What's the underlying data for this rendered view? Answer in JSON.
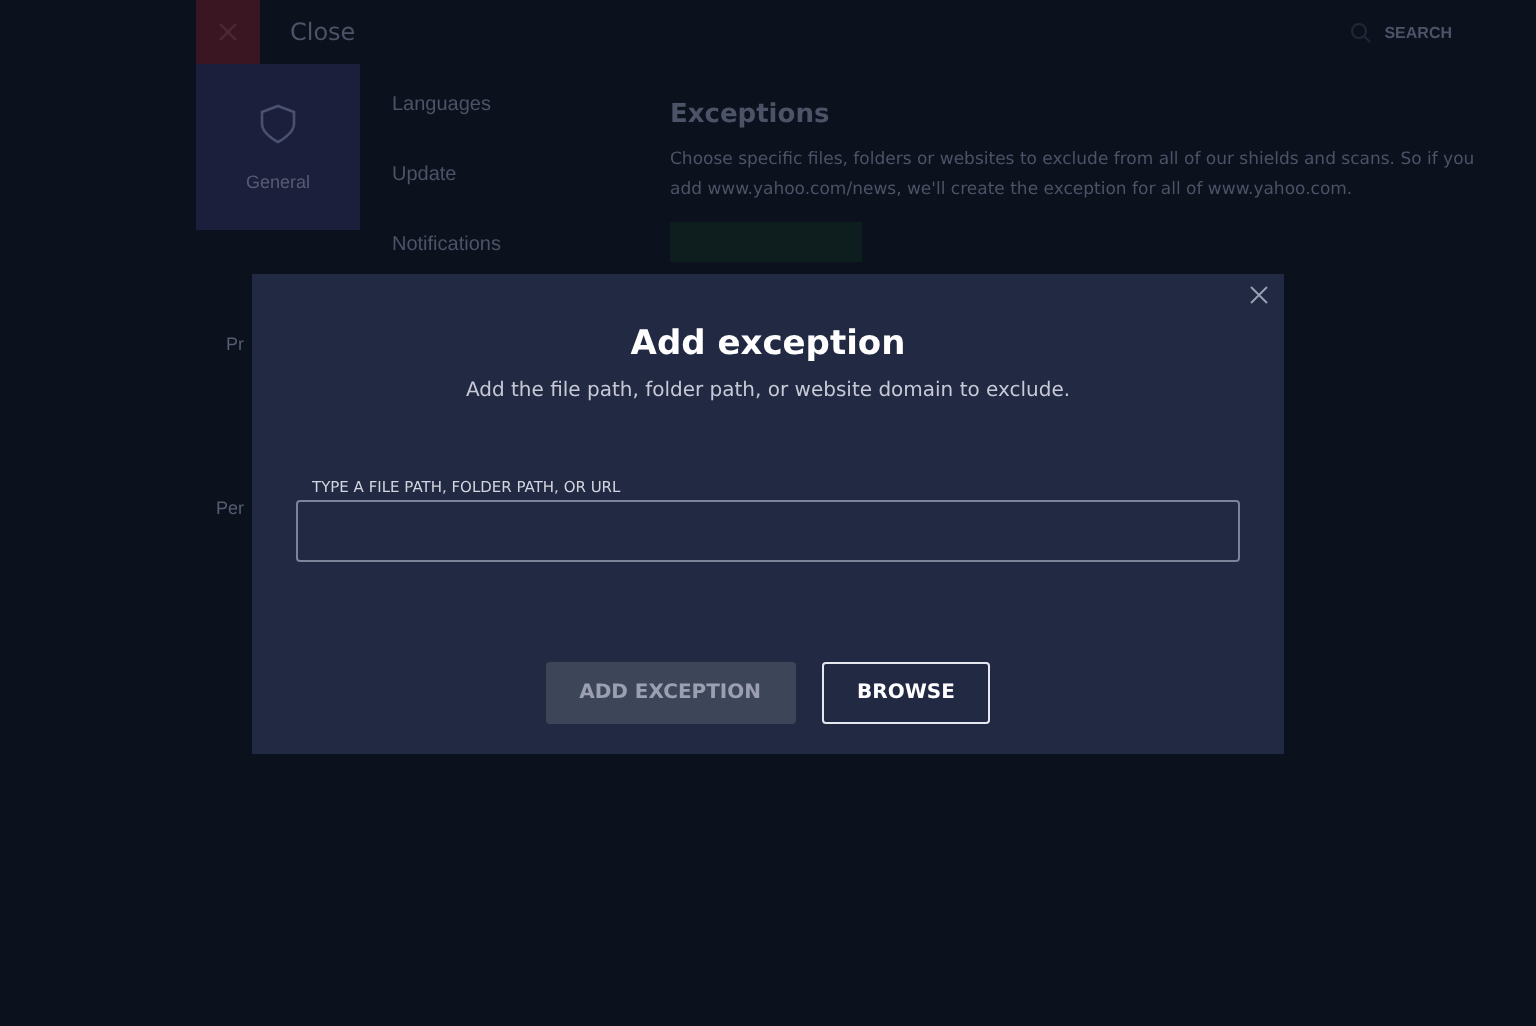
{
  "header": {
    "close_label": "Close",
    "search_label": "SEARCH"
  },
  "sidebar": {
    "items": [
      {
        "label": "General",
        "selected": true
      },
      {
        "label": "Pr",
        "selected": false
      },
      {
        "label": "Per",
        "selected": false
      }
    ]
  },
  "subnav": {
    "items": [
      "Languages",
      "Update",
      "Notifications"
    ]
  },
  "content": {
    "title": "Exceptions",
    "description": "Choose specific files, folders or websites to exclude from all of our shields and scans. So if you add www.yahoo.com/news, we'll create the exception for all of www.yahoo.com."
  },
  "dialog": {
    "title": "Add exception",
    "subtitle": "Add the file path, folder path, or website domain to exclude.",
    "field_label": "TYPE A FILE PATH, FOLDER PATH, OR URL",
    "buttons": [
      {
        "label": "ADD EXCEPTION",
        "kind": "primary",
        "disabled": true
      },
      {
        "label": "BROWSE",
        "kind": "outline",
        "disabled": false
      }
    ]
  }
}
